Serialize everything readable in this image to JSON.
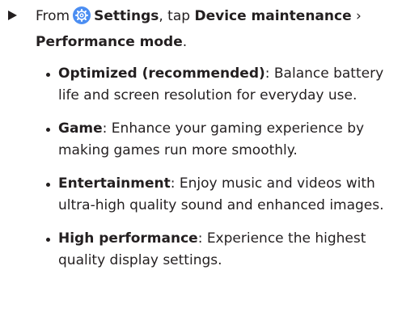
{
  "step": {
    "prefix": "From",
    "settings_label": "Settings",
    "tap_text": ", tap",
    "device_maintenance": "Device maintenance",
    "separator": "›",
    "performance_mode": "Performance mode",
    "suffix": ".",
    "icon": "settings-gear-icon",
    "icon_color": "#4c8ef2"
  },
  "bullets": [
    {
      "term": "Optimized (recommended)",
      "desc": ": Balance battery life and screen resolution for everyday use."
    },
    {
      "term": "Game",
      "desc": ": Enhance your gaming experience by making games run more smoothly."
    },
    {
      "term": "Entertainment",
      "desc": ": Enjoy music and videos with ultra-high quality sound and enhanced images."
    },
    {
      "term": "High performance",
      "desc": ": Experience the highest quality display settings."
    }
  ]
}
